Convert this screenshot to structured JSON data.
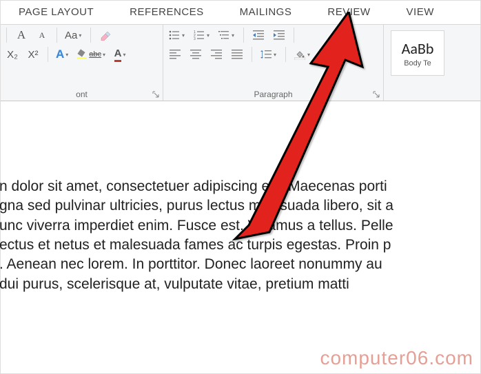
{
  "tabs": {
    "page_layout": "PAGE LAYOUT",
    "references": "REFERENCES",
    "mailings": "MAILINGS",
    "review": "REVIEW",
    "view": "VIEW"
  },
  "font_group": {
    "label": "ont",
    "increase_font": "A",
    "decrease_font": "A",
    "case_button": "Aa",
    "subscript": "X₂",
    "superscript": "X²",
    "text_effects": "A",
    "strikethrough": "abc",
    "font_color": "A"
  },
  "paragraph_group": {
    "label": "Paragraph"
  },
  "styles_group": {
    "style1_sample": "AaBb",
    "style1_name": "Body Te"
  },
  "document": {
    "lines": [
      "n dolor sit amet, consectetuer adipiscing elit. Maecenas porti",
      "gna sed pulvinar ultricies, purus lectus malesuada libero, sit a",
      "unc viverra imperdiet enim. Fusce est. Vivamus a tellus. Pelle",
      "ectus et netus et malesuada fames ac turpis egestas. Proin p",
      ". Aenean nec lorem. In porttitor. Donec laoreet nonummy au",
      " dui purus, scelerisque at, vulputate vitae, pretium matti"
    ]
  },
  "watermark": "computer06.com"
}
